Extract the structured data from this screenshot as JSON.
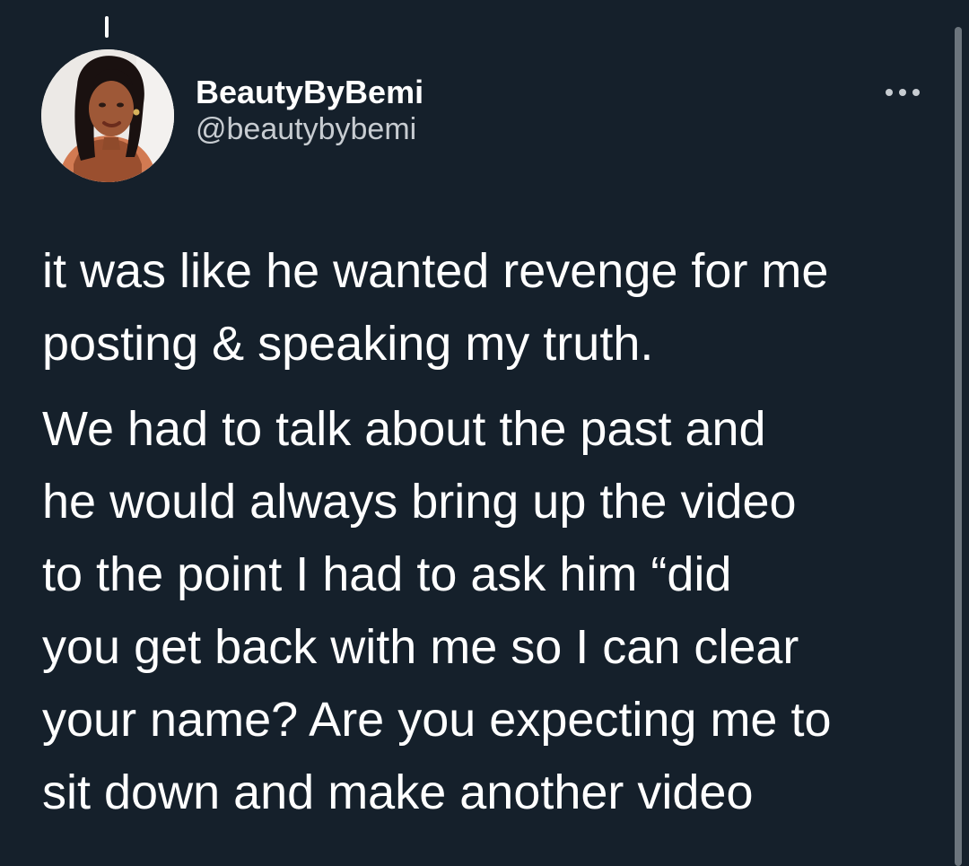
{
  "tweet": {
    "author": {
      "display_name": "BeautyByBemi",
      "handle": "@beautybybemi"
    },
    "text": {
      "paragraph_1": "it was like he wanted revenge for me\nposting & speaking my truth.",
      "paragraph_2": "We had to talk about the past and\nhe would always bring up the video\nto the point I had to ask him “did\nyou get back with me so I can clear\nyour name? Are you expecting me to\nsit down and make another video"
    },
    "more_icon": "more-horizontal-icon"
  },
  "colors": {
    "background": "#15202b",
    "text_primary": "#ffffff",
    "text_secondary": "#c7ccd1"
  }
}
